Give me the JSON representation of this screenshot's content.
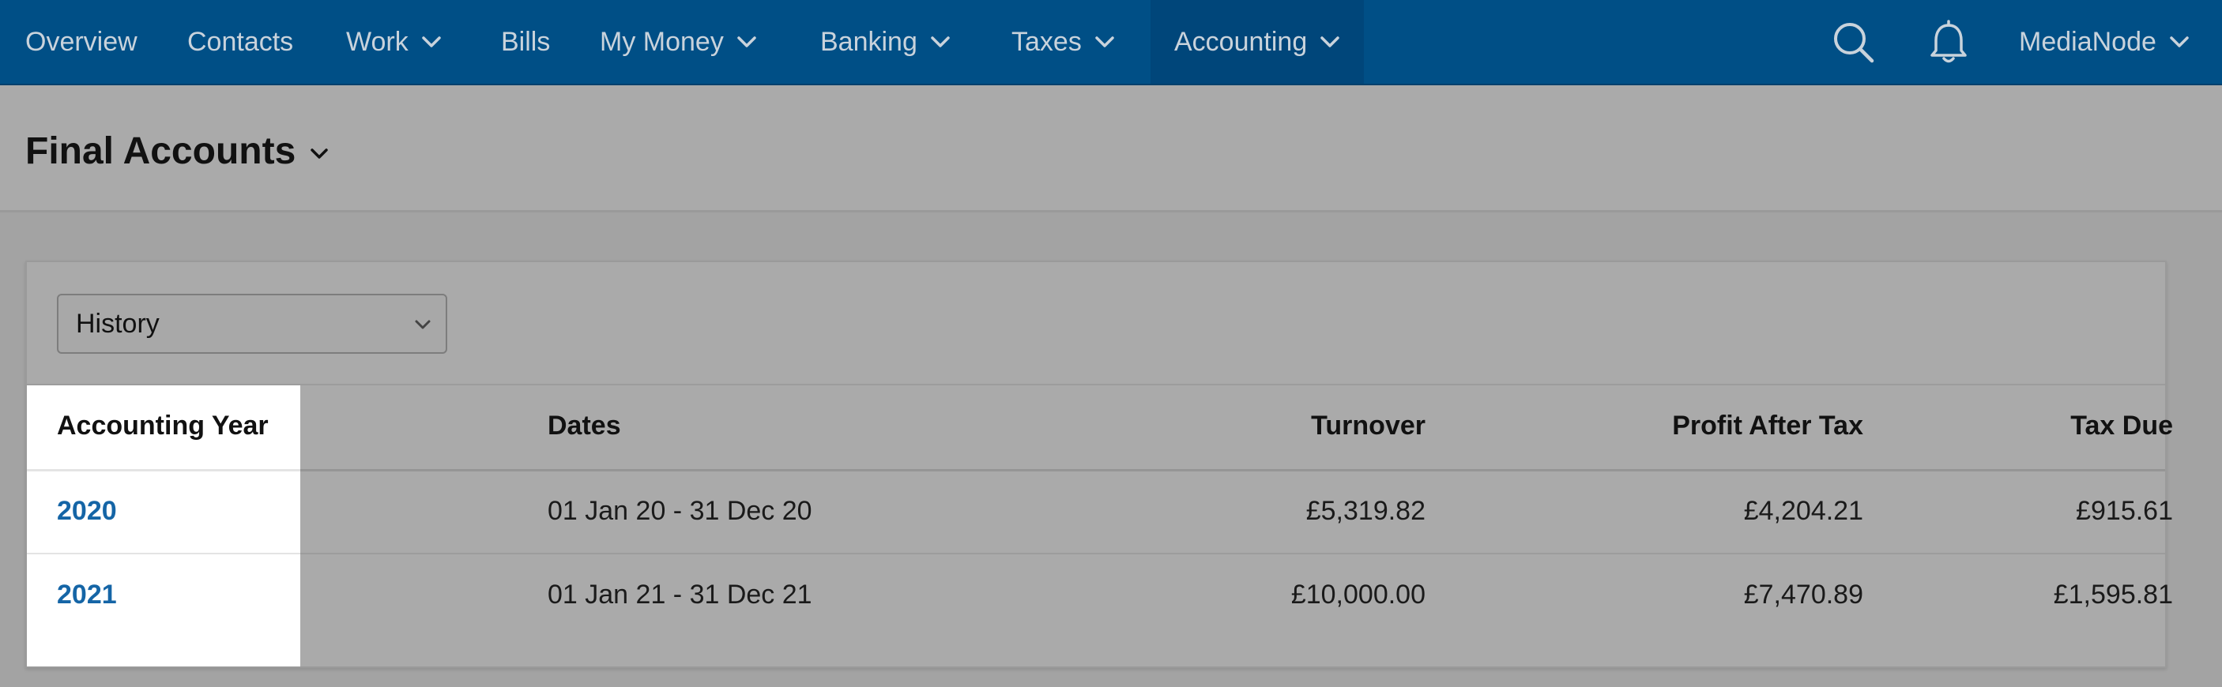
{
  "nav": {
    "items": [
      {
        "label": "Overview",
        "has_dropdown": false
      },
      {
        "label": "Contacts",
        "has_dropdown": false
      },
      {
        "label": "Work",
        "has_dropdown": true
      },
      {
        "label": "Bills",
        "has_dropdown": false
      },
      {
        "label": "My Money",
        "has_dropdown": true
      },
      {
        "label": "Banking",
        "has_dropdown": true
      },
      {
        "label": "Taxes",
        "has_dropdown": true
      },
      {
        "label": "Accounting",
        "has_dropdown": true,
        "active": true
      }
    ],
    "search_icon": "search-icon",
    "notification_icon": "bell-icon",
    "account_label": "MediaNode"
  },
  "page": {
    "title": "Final Accounts"
  },
  "filter": {
    "selected": "History"
  },
  "table": {
    "columns": [
      "Accounting Year",
      "Dates",
      "Turnover",
      "Profit After Tax",
      "Tax Due"
    ],
    "rows": [
      {
        "year": "2020",
        "dates": "01 Jan 20 - 31 Dec 20",
        "turnover": "£5,319.82",
        "profit_after_tax": "£4,204.21",
        "tax_due": "£915.61"
      },
      {
        "year": "2021",
        "dates": "01 Jan 21 - 31 Dec 21",
        "turnover": "£10,000.00",
        "profit_after_tax": "£7,470.89",
        "tax_due": "£1,595.81"
      }
    ]
  },
  "colors": {
    "nav_bg": "#004f86",
    "nav_active_bg": "#00467a",
    "link": "#1565a6",
    "overlay_bg": "#aaaaaa",
    "highlight": "#ffffff"
  }
}
